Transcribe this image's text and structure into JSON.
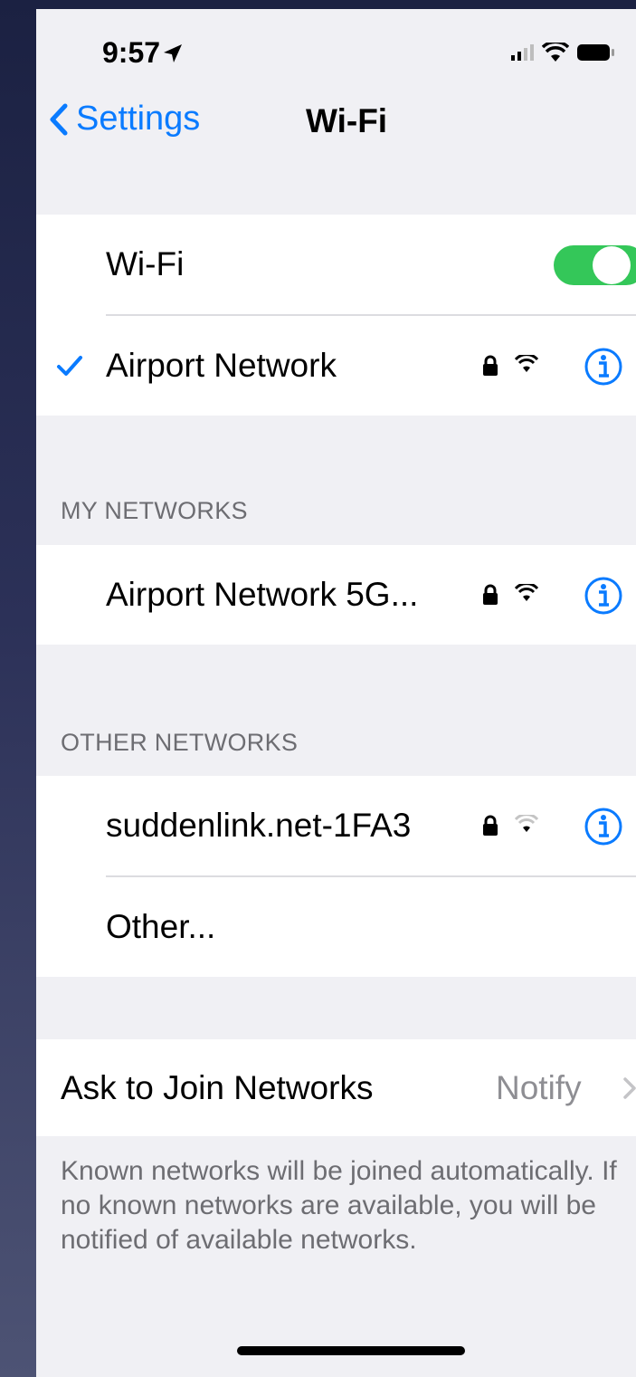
{
  "status_bar": {
    "time": "9:57"
  },
  "nav": {
    "back_label": "Settings",
    "title": "Wi-Fi"
  },
  "wifi_toggle": {
    "label": "Wi-Fi",
    "on": true
  },
  "connected_network": {
    "name": "Airport Network"
  },
  "my_networks": {
    "header": "MY NETWORKS",
    "items": [
      {
        "name": "Airport Network 5G..."
      }
    ]
  },
  "other_networks": {
    "header": "OTHER NETWORKS",
    "items": [
      {
        "name": "suddenlink.net-1FA3"
      }
    ],
    "other_label": "Other..."
  },
  "ask_to_join": {
    "label": "Ask to Join Networks",
    "value": "Notify",
    "description": "Known networks will be joined automatically. If no known networks are available, you will be notified of available networks."
  },
  "colors": {
    "accent": "#0a7bff",
    "toggle_on": "#34c759",
    "background": "#f0f0f4"
  }
}
